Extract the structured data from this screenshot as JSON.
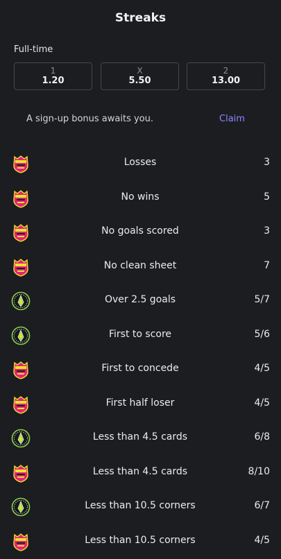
{
  "header": {
    "title": "Streaks"
  },
  "fulltime": {
    "label": "Full-time",
    "odds": [
      {
        "label": "1",
        "value": "1.20"
      },
      {
        "label": "X",
        "value": "5.50"
      },
      {
        "label": "2",
        "value": "13.00"
      }
    ]
  },
  "bonus": {
    "text": "A sign-up bonus awaits you.",
    "claim": "Claim"
  },
  "colors": {
    "pink": "#e8207a",
    "yellow": "#e9e42a",
    "green": "#8fd14f",
    "claim": "#8f86ff"
  },
  "streaks": [
    {
      "label": "Losses",
      "value": "3",
      "team": "pink-crest-icon"
    },
    {
      "label": "No wins",
      "value": "5",
      "team": "pink-crest-icon"
    },
    {
      "label": "No goals scored",
      "value": "3",
      "team": "pink-crest-icon"
    },
    {
      "label": "No clean sheet",
      "value": "7",
      "team": "pink-crest-icon"
    },
    {
      "label": "Over 2.5 goals",
      "value": "5/7",
      "team": "green-crest-icon"
    },
    {
      "label": "First to score",
      "value": "5/6",
      "team": "green-crest-icon"
    },
    {
      "label": "First to concede",
      "value": "4/5",
      "team": "pink-crest-icon"
    },
    {
      "label": "First half loser",
      "value": "4/5",
      "team": "pink-crest-icon"
    },
    {
      "label": "Less than 4.5 cards",
      "value": "6/8",
      "team": "green-crest-icon"
    },
    {
      "label": "Less than 4.5 cards",
      "value": "8/10",
      "team": "pink-crest-icon"
    },
    {
      "label": "Less than 10.5 corners",
      "value": "6/7",
      "team": "green-crest-icon"
    },
    {
      "label": "Less than 10.5 corners",
      "value": "4/5",
      "team": "pink-crest-icon"
    }
  ]
}
